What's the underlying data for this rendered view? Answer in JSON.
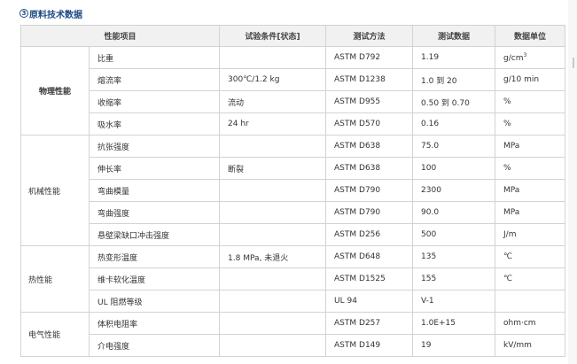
{
  "section": {
    "number": "3",
    "title": "原料技术数据"
  },
  "table": {
    "headers": [
      "性能项目",
      "试验条件[状态]",
      "测试方法",
      "测试数据",
      "数据单位"
    ],
    "groups": [
      {
        "name": "物理性能",
        "bold": true,
        "rows": [
          {
            "property": "比重",
            "condition": "",
            "method": "ASTM D792",
            "value": "1.19",
            "unit": "g/cm",
            "unit_sup": "3"
          },
          {
            "property": "熔流率",
            "condition": "300℃/1.2 kg",
            "method": "ASTM D1238",
            "value": "1.0 到 20",
            "unit": "g/10 min"
          },
          {
            "property": "收缩率",
            "condition": "流动",
            "method": "ASTM D955",
            "value": "0.50 到 0.70",
            "unit": "%"
          },
          {
            "property": "吸水率",
            "condition": "24 hr",
            "method": "ASTM D570",
            "value": "0.16",
            "unit": "%"
          }
        ]
      },
      {
        "name": "机械性能",
        "bold": false,
        "rows": [
          {
            "property": "抗张强度",
            "condition": "",
            "method": "ASTM D638",
            "value": "75.0",
            "unit": "MPa"
          },
          {
            "property": "伸长率",
            "condition": "断裂",
            "method": "ASTM D638",
            "value": "100",
            "unit": "%"
          },
          {
            "property": "弯曲模量",
            "condition": "",
            "method": "ASTM D790",
            "value": "2300",
            "unit": "MPa"
          },
          {
            "property": "弯曲强度",
            "condition": "",
            "method": "ASTM D790",
            "value": "90.0",
            "unit": "MPa"
          },
          {
            "property": "悬壁梁缺口冲击强度",
            "condition": "",
            "method": "ASTM D256",
            "value": "500",
            "unit": "J/m"
          }
        ]
      },
      {
        "name": "热性能",
        "bold": false,
        "rows": [
          {
            "property": "热变形温度",
            "condition": "1.8 MPa, 未退火",
            "method": "ASTM D648",
            "value": "135",
            "unit": "℃"
          },
          {
            "property": "维卡软化温度",
            "condition": "",
            "method": "ASTM D1525",
            "value": "155",
            "unit": "℃"
          },
          {
            "property": "UL 阻燃等级",
            "condition": "",
            "method": "UL 94",
            "value": "V-1",
            "unit": ""
          }
        ]
      },
      {
        "name": "电气性能",
        "bold": false,
        "rows": [
          {
            "property": "体积电阻率",
            "condition": "",
            "method": "ASTM D257",
            "value": "1.0E+15",
            "unit": "ohm·cm"
          },
          {
            "property": "介电强度",
            "condition": "",
            "method": "ASTM D149",
            "value": "19",
            "unit": "kV/mm"
          }
        ]
      }
    ]
  },
  "colors": {
    "title": "#1c4a86",
    "border": "#d3d3d3",
    "header_bg": "#f1f1f1"
  }
}
